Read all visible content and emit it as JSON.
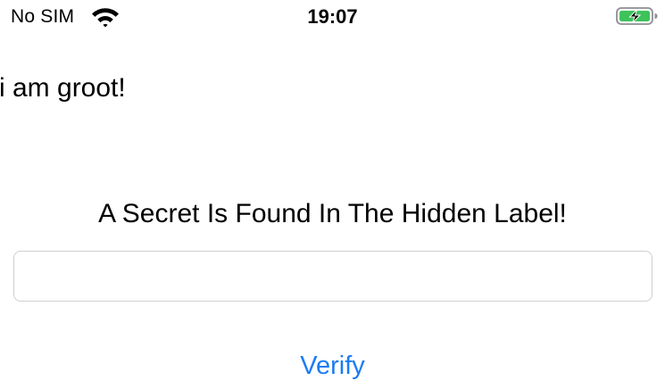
{
  "status_bar": {
    "carrier": "No SIM",
    "time": "19:07",
    "wifi_icon": "wifi-icon",
    "battery_icon": "battery-charging-icon",
    "battery_color": "#3ec25a"
  },
  "main": {
    "top_label": "i am groot!",
    "secret_label": "A Secret Is Found In The Hidden Label!",
    "input": {
      "value": "",
      "placeholder": ""
    },
    "verify_label": "Verify",
    "accent_color": "#1a7cf5"
  }
}
